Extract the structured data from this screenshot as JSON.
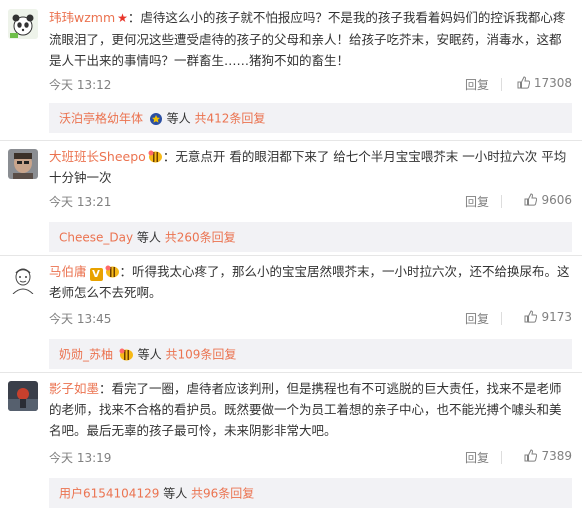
{
  "comments": [
    {
      "user": "玮玮wzmm",
      "separator": "：",
      "text": "虐待这么小的孩子就不怕报应吗？不是我的孩子我看着妈妈们的控诉我都心疼流眼泪了，更何况这些遭受虐待的孩子的父母和亲人！给孩子吃芥末，安眠药，消毒水，这都是人干出来的事情吗？一群畜生……猪狗不如的畜生！",
      "time": "今天 13:12",
      "reply_label": "回复",
      "likes": "17308",
      "sub": {
        "user": "沃泊亭格幼年体",
        "suffix": "等人",
        "total": "共412条回复"
      }
    },
    {
      "user": "大班班长Sheepo",
      "separator": "：",
      "text": "无意点开 看的眼泪都下来了 给七个半月宝宝喂芥末 一小时拉六次 平均十分钟一次",
      "time": "今天 13:21",
      "reply_label": "回复",
      "likes": "9606",
      "sub": {
        "user": "Cheese_Day",
        "suffix": "等人",
        "total": "共260条回复"
      }
    },
    {
      "user": "马伯庸",
      "separator": "：",
      "text": "听得我太心疼了，那么小的宝宝居然喂芥末，一小时拉六次，还不给换尿布。这老师怎么不去死啊。",
      "time": "今天 13:45",
      "reply_label": "回复",
      "likes": "9173",
      "sub": {
        "user": "奶勋_苏柚",
        "suffix": "等人",
        "total": "共109条回复"
      }
    },
    {
      "user": "影子如墨",
      "separator": "：",
      "text": "看完了一圈，虐待者应该判刑，但是携程也有不可逃脱的巨大责任，找来不是老师的老师，找来不合格的看护员。既然要做一个为员工着想的亲子中心，也不能光搏个噱头和美名吧。最后无辜的孩子最可怜，未来阴影非常大吧。",
      "time": "今天 13:19",
      "reply_label": "回复",
      "likes": "7389",
      "sub": {
        "user": "用户6154104129",
        "suffix": "等人",
        "total": "共96条回复"
      }
    }
  ],
  "colors": {
    "username": "#eb7350",
    "meta": "#808080",
    "subbox_bg": "#f2f2f5",
    "text": "#333333"
  },
  "icons": [
    "avatar-panda",
    "avatar-photo",
    "avatar-sketch",
    "avatar-dark",
    "star-badge",
    "bee-badge",
    "v-badge",
    "like-icon",
    "champion-badge"
  ]
}
